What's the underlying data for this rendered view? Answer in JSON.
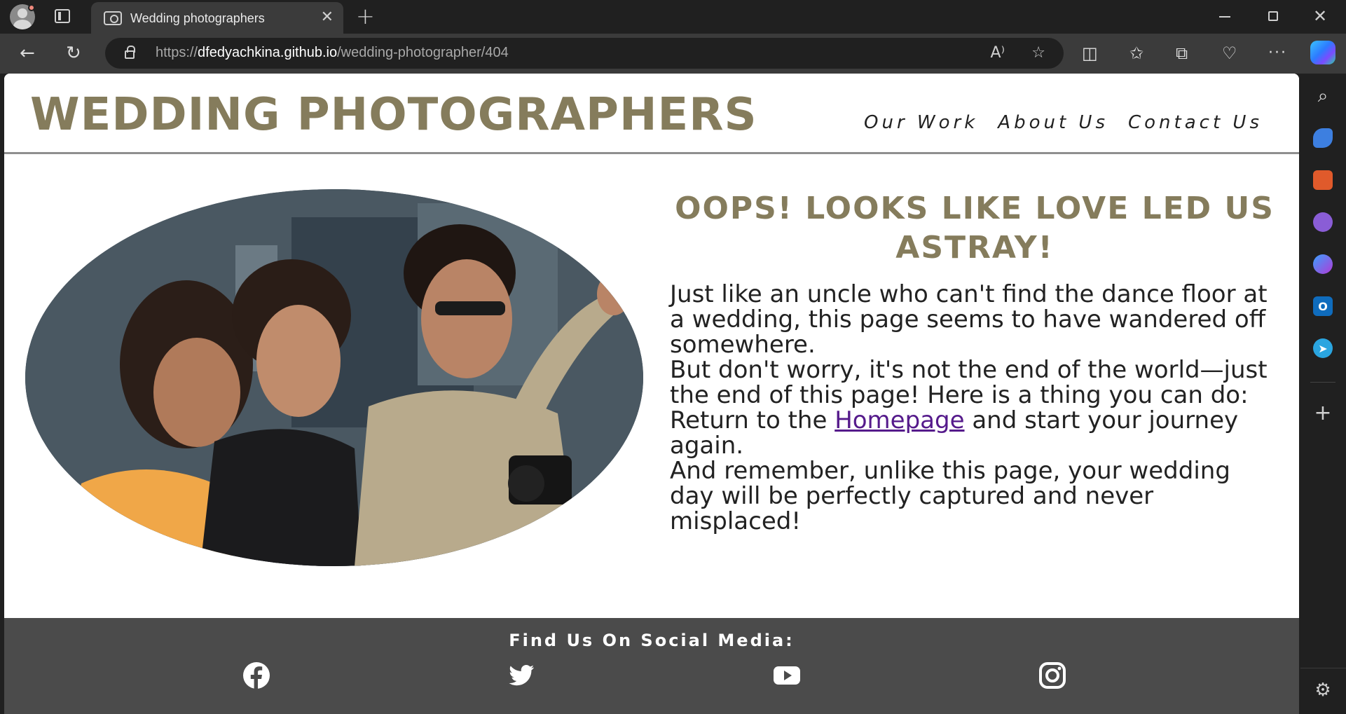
{
  "browser": {
    "tab_title": "Wedding photographers",
    "tab_close": "✕",
    "new_tab": "+",
    "url_scheme": "https://",
    "url_host": "dfedyachkina.github.io",
    "url_path": "/wedding-photographer/404",
    "more": "···",
    "read_aloud_icon": "A⁾",
    "favorite_icon": "☆"
  },
  "site": {
    "logo": "WEDDING PHOTOGRAPHERS",
    "nav": [
      {
        "label": "Our Work"
      },
      {
        "label": "About Us"
      },
      {
        "label": "Contact Us"
      }
    ]
  },
  "error": {
    "title": "OOPS! LOOKS LIKE LOVE LED US ASTRAY!",
    "p1": "Just like an uncle who can't find the dance floor at a wedding, this page seems to have wandered off somewhere.",
    "p2": "But don't worry, it's not the end of the world—just the end of this page! Here is a thing you can do:",
    "p3_before": "Return to the ",
    "p3_link": "Homepage",
    "p3_after": " and start your journey again.",
    "p4": "And remember, unlike this page, your wedding day will be perfectly captured and never misplaced!"
  },
  "footer": {
    "heading": "Find Us On Social Media:",
    "social": [
      "facebook-icon",
      "twitter-icon",
      "youtube-icon",
      "instagram-icon"
    ]
  },
  "colors": {
    "brand": "#857c5c",
    "footer_bg": "#4b4b4b",
    "link_visited": "#551a8b"
  }
}
